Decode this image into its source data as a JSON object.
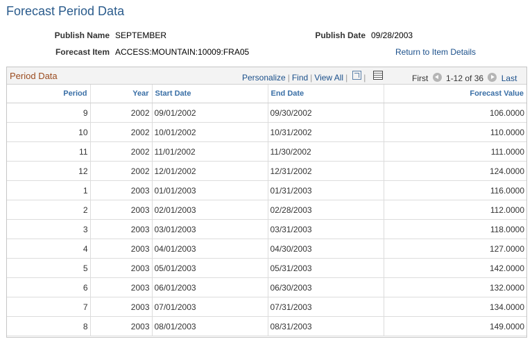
{
  "page": {
    "title": "Forecast Period Data"
  },
  "header": {
    "publish_name_label": "Publish Name",
    "publish_name_value": "SEPTEMBER",
    "publish_date_label": "Publish Date",
    "publish_date_value": "09/28/2003",
    "forecast_item_label": "Forecast Item",
    "forecast_item_value": "ACCESS:MOUNTAIN:10009:FRA05",
    "return_link": "Return to Item Details"
  },
  "grid": {
    "title": "Period Data",
    "tools": {
      "personalize": "Personalize",
      "find": "Find",
      "view_all": "View All"
    },
    "pager": {
      "first": "First",
      "range": "1-12 of 36",
      "last": "Last"
    },
    "columns": [
      "Period",
      "Year",
      "Start Date",
      "End Date",
      "Forecast Value"
    ],
    "rows": [
      [
        "9",
        "2002",
        "09/01/2002",
        "09/30/2002",
        "106.0000"
      ],
      [
        "10",
        "2002",
        "10/01/2002",
        "10/31/2002",
        "110.0000"
      ],
      [
        "11",
        "2002",
        "11/01/2002",
        "11/30/2002",
        "111.0000"
      ],
      [
        "12",
        "2002",
        "12/01/2002",
        "12/31/2002",
        "124.0000"
      ],
      [
        "1",
        "2003",
        "01/01/2003",
        "01/31/2003",
        "116.0000"
      ],
      [
        "2",
        "2003",
        "02/01/2003",
        "02/28/2003",
        "112.0000"
      ],
      [
        "3",
        "2003",
        "03/01/2003",
        "03/31/2003",
        "118.0000"
      ],
      [
        "4",
        "2003",
        "04/01/2003",
        "04/30/2003",
        "127.0000"
      ],
      [
        "5",
        "2003",
        "05/01/2003",
        "05/31/2003",
        "142.0000"
      ],
      [
        "6",
        "2003",
        "06/01/2003",
        "06/30/2003",
        "132.0000"
      ],
      [
        "7",
        "2003",
        "07/01/2003",
        "07/31/2003",
        "134.0000"
      ],
      [
        "8",
        "2003",
        "08/01/2003",
        "08/31/2003",
        "149.0000"
      ]
    ]
  }
}
